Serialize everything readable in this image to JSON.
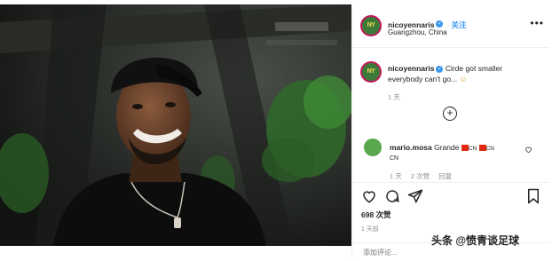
{
  "post": {
    "username": "nicoyennaris",
    "follow_label": "关注",
    "location": "Guangzhou, China",
    "more_glyph": "•••",
    "avatar_text": "NY"
  },
  "caption": {
    "username": "nicoyennaris",
    "text_line1": "Cirde got smaller",
    "text_line2": "everybody can't go...",
    "emoji": "☺",
    "time": "1 天"
  },
  "load_more_glyph": "+",
  "comment": {
    "username": "mario.mosa",
    "text": "Grande",
    "flag_label": "CN",
    "time": "1 天",
    "likes": "2 次赞",
    "reply_label": "回复"
  },
  "actions": {
    "like_count": "698 次赞",
    "date": "1 天前",
    "comment_placeholder": "添加评论..."
  },
  "watermark": "头条 @愤青谈足球",
  "colors": {
    "link": "#3897f0",
    "text": "#262626",
    "muted": "#8e8e8e"
  }
}
